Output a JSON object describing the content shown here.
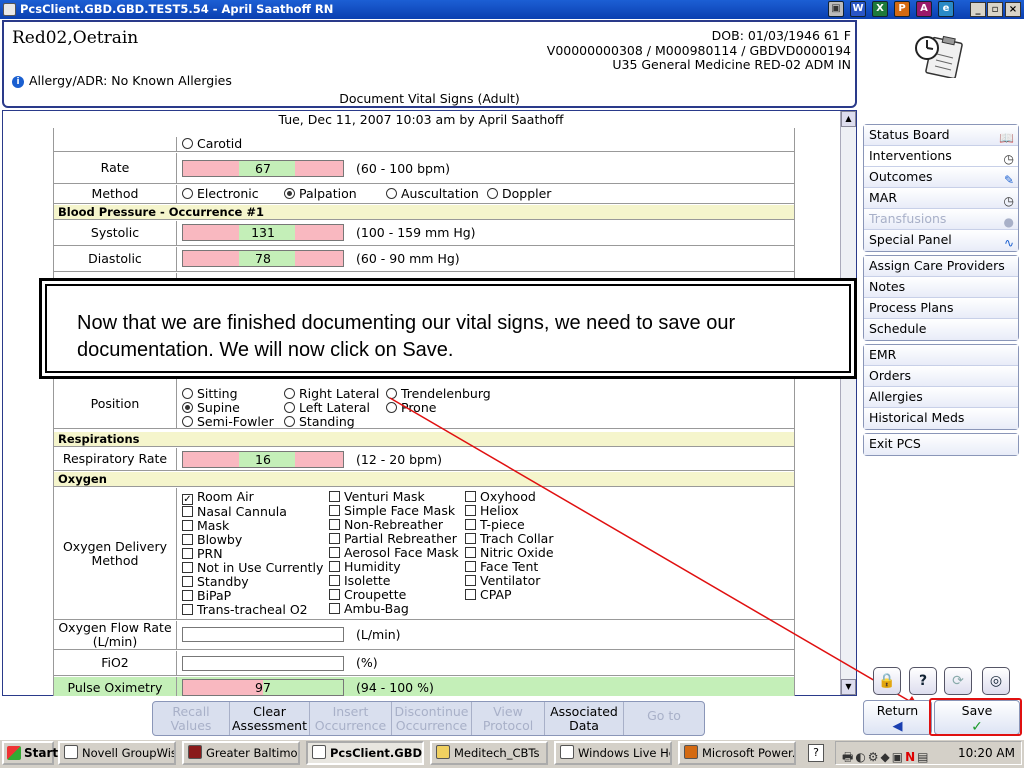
{
  "window": {
    "title": "PcsClient.GBD.GBD.TEST5.54 - April Saathoff RN"
  },
  "patient": {
    "name": "Red02,Oetrain",
    "dob": "DOB: 01/03/1946 61 F",
    "ids": "V00000000308 / M000980114 / GBDVD0000194",
    "location": "U35 General Medicine  RED-02  ADM IN",
    "allergy": "Allergy/ADR: No Known Allergies",
    "document_title": "Document Vital Signs (Adult)"
  },
  "header_strip": {
    "date_line": "Tue,  Dec 11, 2007 10:03 am  by  April Saathoff"
  },
  "form": {
    "carotid": "Carotid",
    "rate": {
      "label": "Rate",
      "value": "67",
      "range": "(60 - 100 bpm)"
    },
    "method": {
      "label": "Method",
      "options": [
        "Electronic",
        "Palpation",
        "Auscultation",
        "Doppler"
      ],
      "selected": "Palpation"
    },
    "bp_section": "Blood Pressure - Occurrence #1",
    "systolic": {
      "label": "Systolic",
      "value": "131",
      "range": "(100 - 159 mm Hg)"
    },
    "diastolic": {
      "label": "Diastolic",
      "value": "78",
      "range": "(60 - 90 mm Hg)"
    },
    "position": {
      "label": "Position",
      "options": [
        "Sitting",
        "Right Lateral",
        "Trendelenburg",
        "Supine",
        "Left Lateral",
        "Prone",
        "Semi-Fowler",
        "Standing"
      ],
      "selected": "Supine"
    },
    "resp_section": "Respirations",
    "resp_rate": {
      "label": "Respiratory Rate",
      "value": "16",
      "range": "(12 - 20 bpm)"
    },
    "oxygen_section": "Oxygen",
    "oxygen_delivery": {
      "label": "Oxygen Delivery Method",
      "col1": [
        "Room Air",
        "Nasal Cannula",
        "Mask",
        "Blowby",
        "PRN",
        "Not in Use Currently",
        "Standby",
        "BiPaP",
        "Trans-tracheal O2"
      ],
      "col2": [
        "Venturi Mask",
        "Simple Face Mask",
        "Non-Rebreather",
        "Partial Rebreather",
        "Aerosol Face Mask",
        "Humidity",
        "Isolette",
        "Croupette",
        "Ambu-Bag"
      ],
      "col3": [
        "Oxyhood",
        "Heliox",
        "T-piece",
        "Trach Collar",
        "Nitric Oxide",
        "Face Tent",
        "Ventilator",
        "CPAP"
      ],
      "checked": "Room Air"
    },
    "flow_rate": {
      "label": "Oxygen Flow Rate (L/min)",
      "unit": "(L/min)",
      "value": ""
    },
    "fio2": {
      "label": "FiO2",
      "unit": "(%)",
      "value": ""
    },
    "pulse_ox": {
      "label": "Pulse Oximetry",
      "value": "97",
      "range": "(94 - 100 %)"
    }
  },
  "callout": {
    "text": "Now that we are finished documenting our vital signs, we need to save our documentation. We will now click on Save."
  },
  "nav": {
    "group1": [
      {
        "label": "Status Board",
        "icon": "book-icon"
      },
      {
        "label": "Interventions",
        "icon": "clock-icon"
      },
      {
        "label": "Outcomes",
        "icon": "pencil-icon"
      },
      {
        "label": "MAR",
        "icon": "clock-icon"
      },
      {
        "label": "Transfusions",
        "icon": "drop-icon",
        "disabled": true
      },
      {
        "label": "Special Panel",
        "icon": "pulse-icon"
      }
    ],
    "group2": [
      "Assign Care Providers",
      "Notes",
      "Process Plans",
      "Schedule"
    ],
    "group3": [
      "EMR",
      "Orders",
      "Allergies",
      "Historical Meds"
    ],
    "group4": [
      "Exit PCS"
    ]
  },
  "toolbar": {
    "recall": "Recall Values",
    "clear": "Clear Assessment",
    "insert": "Insert Occurrence",
    "discontinue": "Discontinue Occurrence",
    "view": "View Protocol",
    "associated": "Associated Data",
    "goto": "Go to"
  },
  "actions": {
    "return_label": "Return",
    "save_label": "Save"
  },
  "taskbar": {
    "start": "Start",
    "items": [
      "Novell GroupWis...",
      "Greater Baltimor...",
      "PcsClient.GBD....",
      "Meditech_CBTs",
      "Windows Live Ho...",
      "Microsoft Power..."
    ],
    "clock": "10:20 AM"
  },
  "colors": {
    "accent": "#2a3a8a",
    "normal_range": "#c4efb8",
    "abnormal_range": "#f9b8c0",
    "highlight": "#e01010",
    "section_bg": "#f5f5cc"
  }
}
